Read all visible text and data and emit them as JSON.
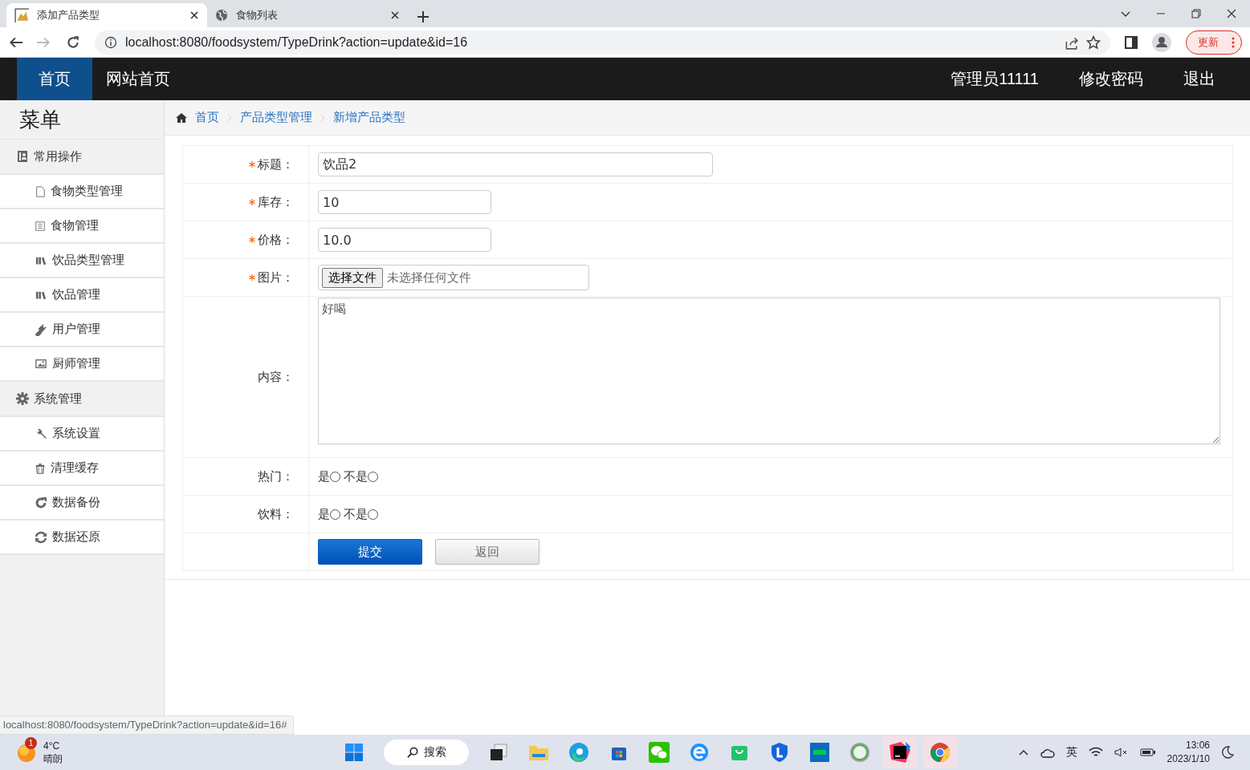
{
  "browser": {
    "tabs": [
      {
        "title": "添加产品类型",
        "selected": true
      },
      {
        "title": "食物列表",
        "selected": false
      }
    ],
    "url": "localhost:8080/foodsystem/TypeDrink?action=update&id=16",
    "update_button": "更新"
  },
  "navbar": {
    "left": [
      {
        "label": "首页",
        "selected": true
      },
      {
        "label": "网站首页",
        "selected": false
      }
    ],
    "right": [
      "管理员11111",
      "修改密码",
      "退出"
    ]
  },
  "sidebar": {
    "title": "菜单",
    "groups": [
      {
        "label": "常用操作",
        "items": [
          "食物类型管理",
          "食物管理",
          "饮品类型管理",
          "饮品管理",
          "用户管理",
          "厨师管理"
        ]
      },
      {
        "label": "系统管理",
        "items": [
          "系统设置",
          "清理缓存",
          "数据备份",
          "数据还原"
        ]
      }
    ]
  },
  "breadcrumb": [
    "首页",
    "产品类型管理",
    "新增产品类型"
  ],
  "form": {
    "rows": [
      {
        "label": "标题：",
        "required": true,
        "kind": "text",
        "value": "饮品2"
      },
      {
        "label": "库存：",
        "required": true,
        "kind": "number",
        "value": "10"
      },
      {
        "label": "价格：",
        "required": true,
        "kind": "number",
        "value": "10.0"
      },
      {
        "label": "图片：",
        "required": true,
        "kind": "file",
        "button": "选择文件",
        "value": "未选择任何文件"
      },
      {
        "label": "内容：",
        "required": false,
        "kind": "textarea",
        "value": "好喝"
      },
      {
        "label": "热门：",
        "required": false,
        "kind": "radio",
        "options": [
          {
            "label": "是",
            "selected": false
          },
          {
            "label": "不是",
            "selected": false
          }
        ]
      },
      {
        "label": "饮料：",
        "required": false,
        "kind": "radio",
        "options": [
          {
            "label": "是",
            "selected": false
          },
          {
            "label": "不是",
            "selected": false
          }
        ]
      }
    ],
    "buttons": [
      {
        "label": "提交",
        "kind": "primary"
      },
      {
        "label": "返回",
        "kind": "secondary"
      }
    ]
  },
  "status_url": "localhost:8080/foodsystem/TypeDrink?action=update&id=16#",
  "taskbar": {
    "weather": {
      "badge": "1",
      "temperature": "4°C",
      "condition": "晴朗"
    },
    "search": "搜索",
    "apps": [
      {
        "active": false
      },
      {
        "active": false
      },
      {
        "active": false
      },
      {
        "active": false
      },
      {
        "active": false
      },
      {
        "active": false
      },
      {
        "active": false
      },
      {
        "active": false
      },
      {
        "active": false
      },
      {
        "active": false
      },
      {
        "active": true
      },
      {
        "active": true
      }
    ],
    "language": "英",
    "time": "13:06",
    "date": "2023/1/10"
  }
}
